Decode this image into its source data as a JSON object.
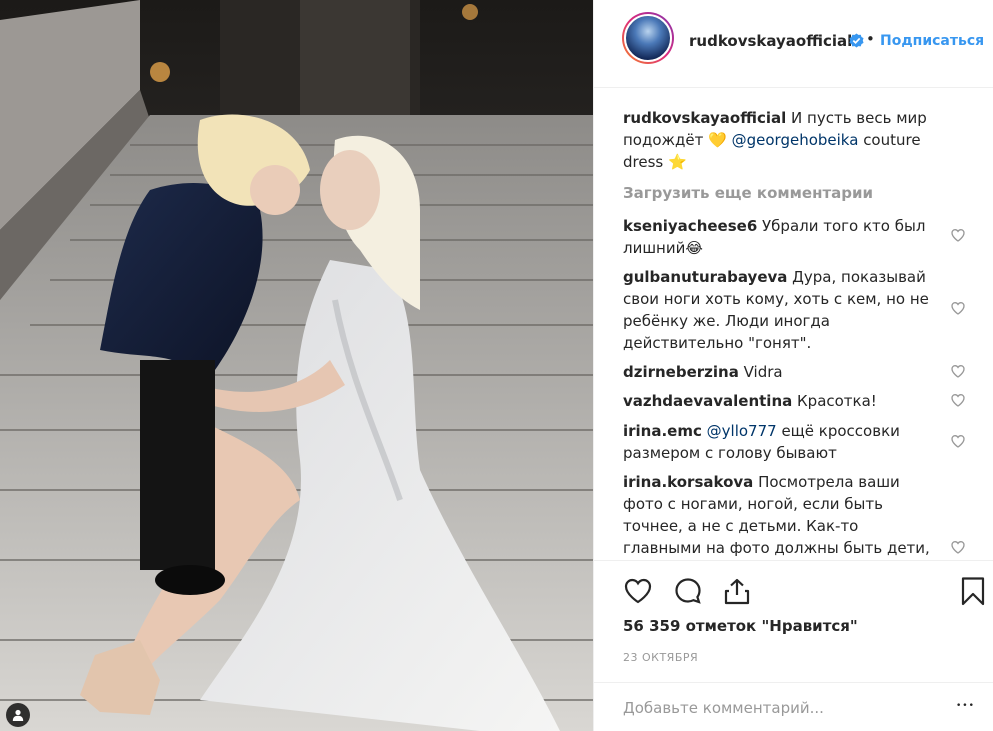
{
  "post": {
    "username": "rudkovskayaofficial",
    "dot": "•",
    "follow_label": "Подписаться",
    "caption_text": " И пусть весь мир подождёт ",
    "caption_heart": "💛",
    "caption_mention": "@georgehobeika",
    "caption_tail": " couture dress ",
    "caption_star": "⭐",
    "load_more_label": "Загрузить еще комментарии",
    "likes_text": "56 359 отметок \"Нравится\"",
    "date_text": "23 ОКТЯБРЯ",
    "add_comment_placeholder": "Добавьте комментарий...",
    "more_dots": "•••"
  },
  "comments": [
    {
      "user": "kseniyacheese6",
      "text": " Убрали того кто был лишний😂"
    },
    {
      "user": "gulbanuturabayeva",
      "text": " Дура, показывай свои ноги хоть кому, хоть с кем, но не ребёнку же. Люди иногда действительно \"гонят\"."
    },
    {
      "user": "dzirneberzina",
      "text": " Vidra"
    },
    {
      "user": "vazhdaevavalentina",
      "text": " Красотка!"
    },
    {
      "user": "irina.emc",
      "mention": " @yllo777",
      "text": " ещё кроссовки размером с голову бывают"
    },
    {
      "user": "irina.korsakova",
      "text": " Посмотрела ваши фото с ногами, ногой, если быть точнее, а не с детьми. Как-то главными на фото должны быть дети,"
    }
  ],
  "icons": {
    "verified": "verified-badge-icon",
    "heart": "heart-outline-icon",
    "comment": "comment-bubble-icon",
    "share": "share-upload-icon",
    "save": "bookmark-icon",
    "tag": "person-tag-icon"
  },
  "colors": {
    "link_blue": "#3897f0",
    "mention_blue": "#003569",
    "muted_gray": "#999999",
    "text": "#262626",
    "divider": "#efefef"
  }
}
